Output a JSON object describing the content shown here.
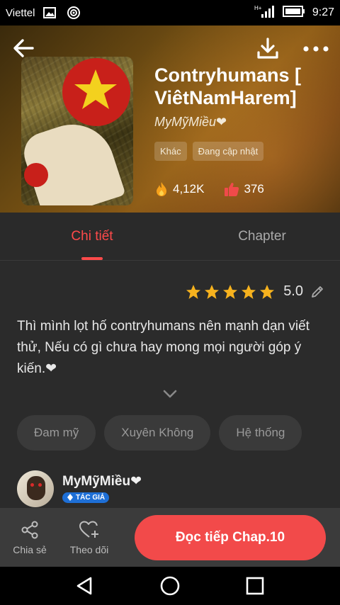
{
  "status_bar": {
    "carrier": "Viettel",
    "time": "9:27"
  },
  "header": {
    "title": "Contryhumans [ ViêtNamHarem]",
    "author": "MyMỹMiều❤",
    "tags": [
      "Khác",
      "Đang cập nhật"
    ],
    "views": "4,12K",
    "likes": "376"
  },
  "tabs": [
    {
      "label": "Chi tiết",
      "active": true
    },
    {
      "label": "Chapter",
      "active": false
    }
  ],
  "rating": {
    "stars": 5,
    "value": "5.0"
  },
  "description": "Thì mình lọt hố contryhumans nên mạnh dạn viết thử, Nếu có gì chưa hay mong mọi người góp ý kiến.❤",
  "genres": [
    "Đam mỹ",
    "Xuyên Không",
    "Hệ thống"
  ],
  "author_row": {
    "name": "MyMỹMiều❤",
    "badge": "TÁC GIẢ"
  },
  "actions": {
    "share_label": "Chia sẻ",
    "follow_label": "Theo dõi",
    "read_label": "Đọc tiếp Chap.10"
  },
  "colors": {
    "accent": "#f24a4a",
    "background": "#2b2b2b",
    "badge": "#1e6fd6"
  },
  "icons": [
    "back-arrow-icon",
    "download-icon",
    "more-icon",
    "fire-icon",
    "thumbs-up-icon",
    "star-icon",
    "edit-icon",
    "chevron-down-icon",
    "share-icon",
    "heart-plus-icon",
    "nav-back-icon",
    "nav-home-icon",
    "nav-recents-icon"
  ]
}
